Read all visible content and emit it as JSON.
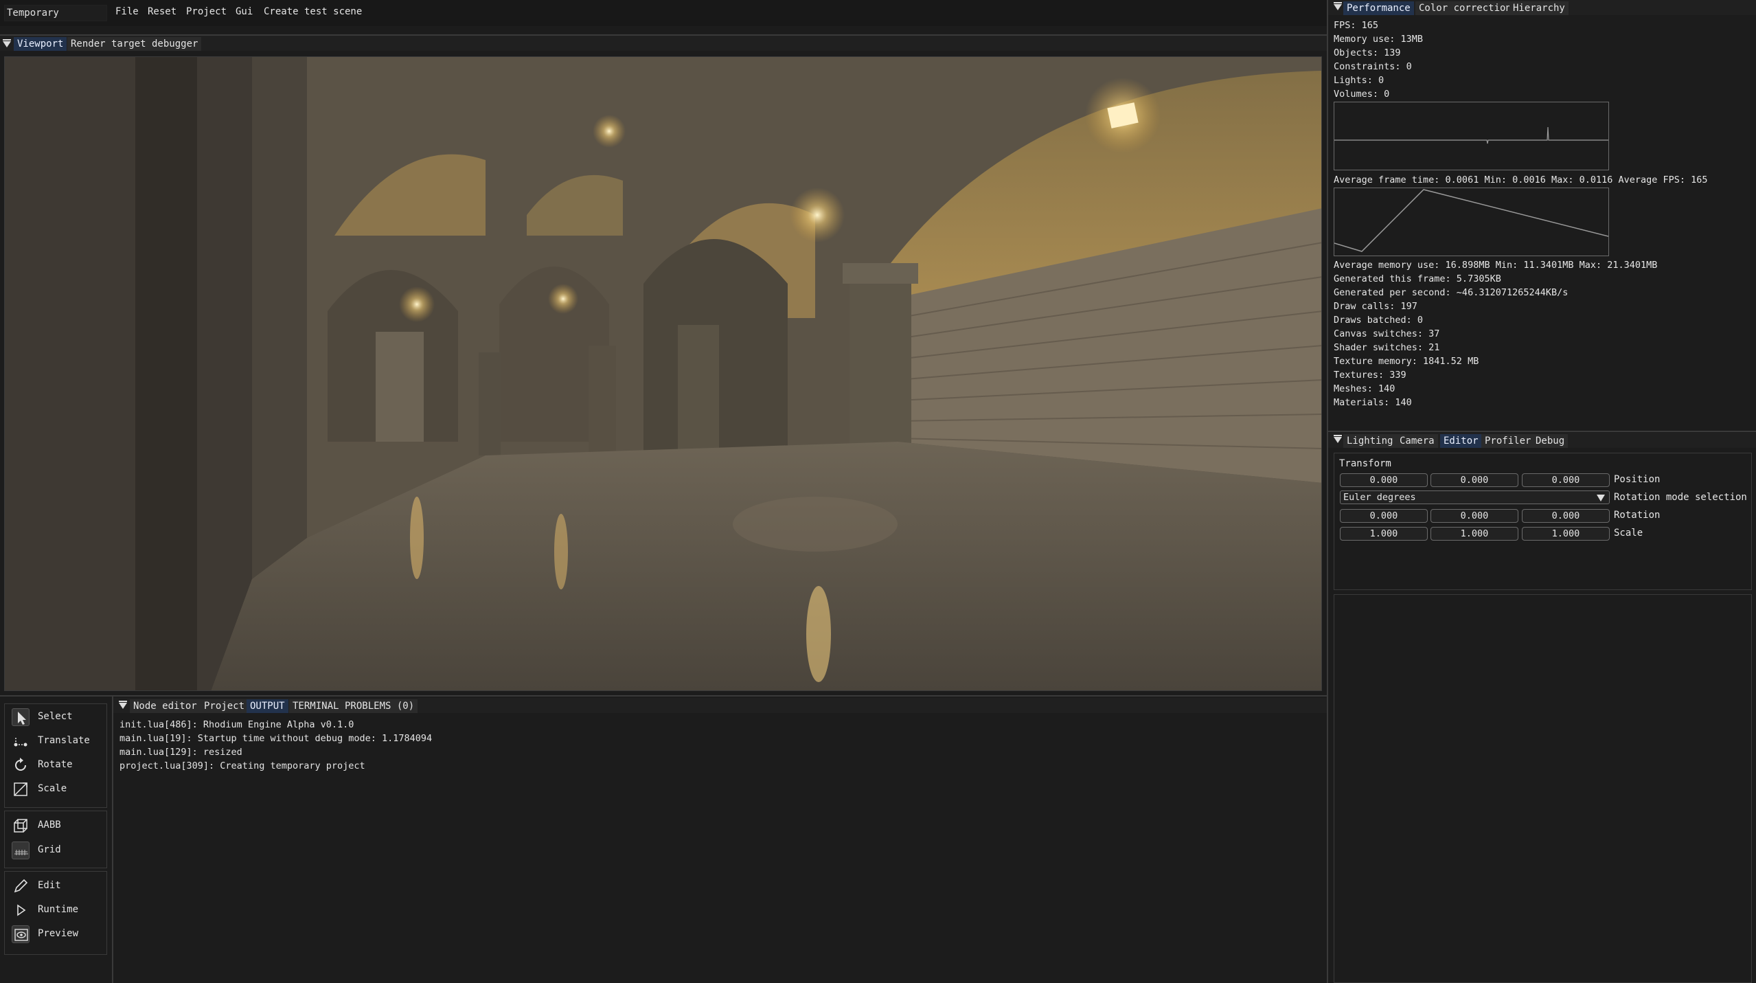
{
  "menubar": {
    "project_name": "Temporary",
    "items": [
      "File",
      "Reset",
      "Project",
      "Gui",
      "Create test scene"
    ]
  },
  "viewport_tabs": [
    "Viewport",
    "Render target debugger"
  ],
  "bottom_tabs": [
    "Node editor",
    "Project",
    "OUTPUT",
    "TERMINAL",
    "PROBLEMS (0)"
  ],
  "tools": {
    "transform": [
      {
        "label": "Select",
        "icon": "cursor-icon"
      },
      {
        "label": "Translate",
        "icon": "move-icon"
      },
      {
        "label": "Rotate",
        "icon": "rotate-icon"
      },
      {
        "label": "Scale",
        "icon": "scale-icon"
      }
    ],
    "view": [
      {
        "label": "AABB",
        "icon": "cube-icon"
      },
      {
        "label": "Grid",
        "icon": "grid-icon"
      }
    ],
    "mode": [
      {
        "label": "Edit",
        "icon": "pencil-icon"
      },
      {
        "label": "Runtime",
        "icon": "play-icon"
      },
      {
        "label": "Preview",
        "icon": "eye-icon"
      }
    ]
  },
  "output_log": [
    "init.lua[486]: Rhodium Engine Alpha v0.1.0",
    "main.lua[19]: Startup time without debug mode: 1.1784094",
    "main.lua[129]: resized",
    "project.lua[309]: Creating temporary project"
  ],
  "top_right_tabs": [
    "Performance",
    "Color correction",
    "Hierarchy"
  ],
  "performance": {
    "stats_top": [
      "FPS: 165",
      "Memory use: 13MB",
      "Objects: 139",
      "Constraints: 0",
      "Lights: 0",
      "Volumes: 0"
    ],
    "frame_time_line": "Average frame time: 0.0061 Min: 0.0016 Max: 0.0116 Average FPS: 165",
    "memory_line": "Average memory use: 16.898MB Min: 11.3401MB Max: 21.3401MB",
    "stats_bottom": [
      "Generated this frame: 5.7305KB",
      "Generated per second: ~46.312071265244KB/s",
      "Draw calls: 197",
      "Draws batched: 0",
      "Canvas switches: 37",
      "Shader switches: 21",
      "Texture memory: 1841.52 MB",
      "Textures: 339",
      "Meshes: 140",
      "Materials: 140"
    ]
  },
  "bottom_right_tabs": [
    "Lighting",
    "Camera",
    "Editor",
    "Profiler",
    "Debug"
  ],
  "transform": {
    "title": "Transform",
    "position": [
      "0.000",
      "0.000",
      "0.000"
    ],
    "position_label": "Position",
    "rotation_mode": "Euler degrees",
    "rotation_mode_label": "Rotation mode selection",
    "rotation": [
      "0.000",
      "0.000",
      "0.000"
    ],
    "rotation_label": "Rotation",
    "scale": [
      "1.000",
      "1.000",
      "1.000"
    ],
    "scale_label": "Scale"
  },
  "colors": {
    "active_tab": "#22324c",
    "background": "#1c1c1c",
    "panel_border": "#3a3a3a"
  }
}
